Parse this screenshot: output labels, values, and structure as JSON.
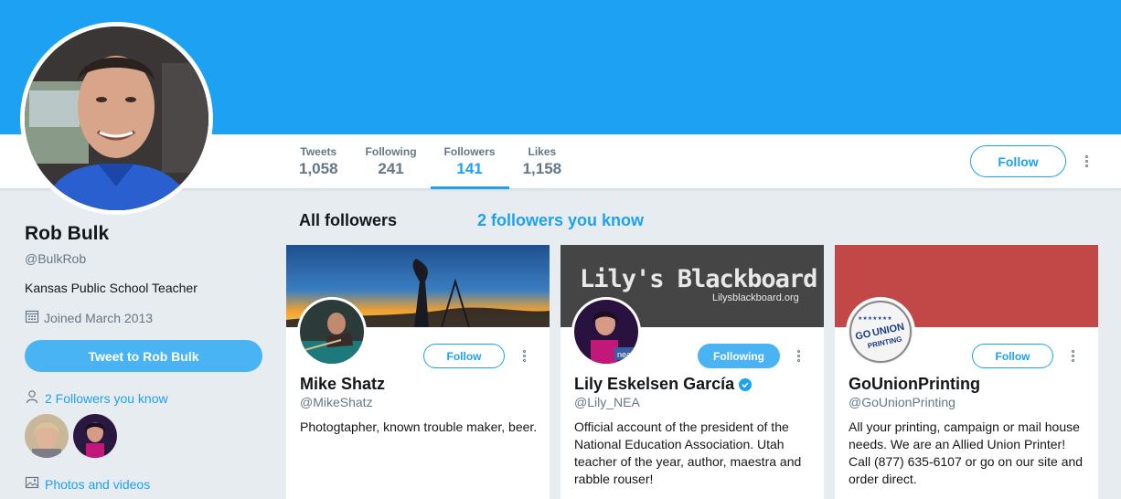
{
  "colors": {
    "accent": "#1da1f2",
    "banner": "#1da1f2",
    "page_bg": "#e6ecf0"
  },
  "profile": {
    "name": "Rob Bulk",
    "handle": "@BulkRob",
    "bio": "Kansas Public School Teacher",
    "joined": "Joined March 2013",
    "tweet_to_label": "Tweet to Rob Bulk",
    "followers_you_know_link": "2 Followers you know",
    "photos_link": "Photos and videos"
  },
  "nav": {
    "stats": [
      {
        "label": "Tweets",
        "value": "1,058"
      },
      {
        "label": "Following",
        "value": "241"
      },
      {
        "label": "Followers",
        "value": "141",
        "active": true
      },
      {
        "label": "Likes",
        "value": "1,158"
      }
    ],
    "follow_label": "Follow"
  },
  "tabs": {
    "all_followers": "All followers",
    "followers_you_know": "2 followers you know"
  },
  "cards": [
    {
      "name": "Mike Shatz",
      "handle": "@MikeShatz",
      "bio": "Photogtapher, known trouble maker, beer.",
      "button": "Follow",
      "verified": false
    },
    {
      "name": "Lily Eskelsen García",
      "handle": "@Lily_NEA",
      "bio": "Official account of the president of the National Education Association. Utah teacher of the year, author, maestra and rabble rouser!",
      "button": "Following",
      "verified": true,
      "banner_title": "Lily's Blackboard",
      "banner_url": "Lilysblackboard.org"
    },
    {
      "name": "GoUnionPrinting",
      "handle": "@GoUnionPrinting",
      "bio": "All your printing, campaign or mail house needs. We are an Allied Union Printer! Call (877) 635-6107 or go on our site and order direct.",
      "button": "Follow",
      "verified": false,
      "logo_text_top": "GO",
      "logo_text_mid": "UNION",
      "logo_text_bottom": "PRINTING"
    }
  ]
}
